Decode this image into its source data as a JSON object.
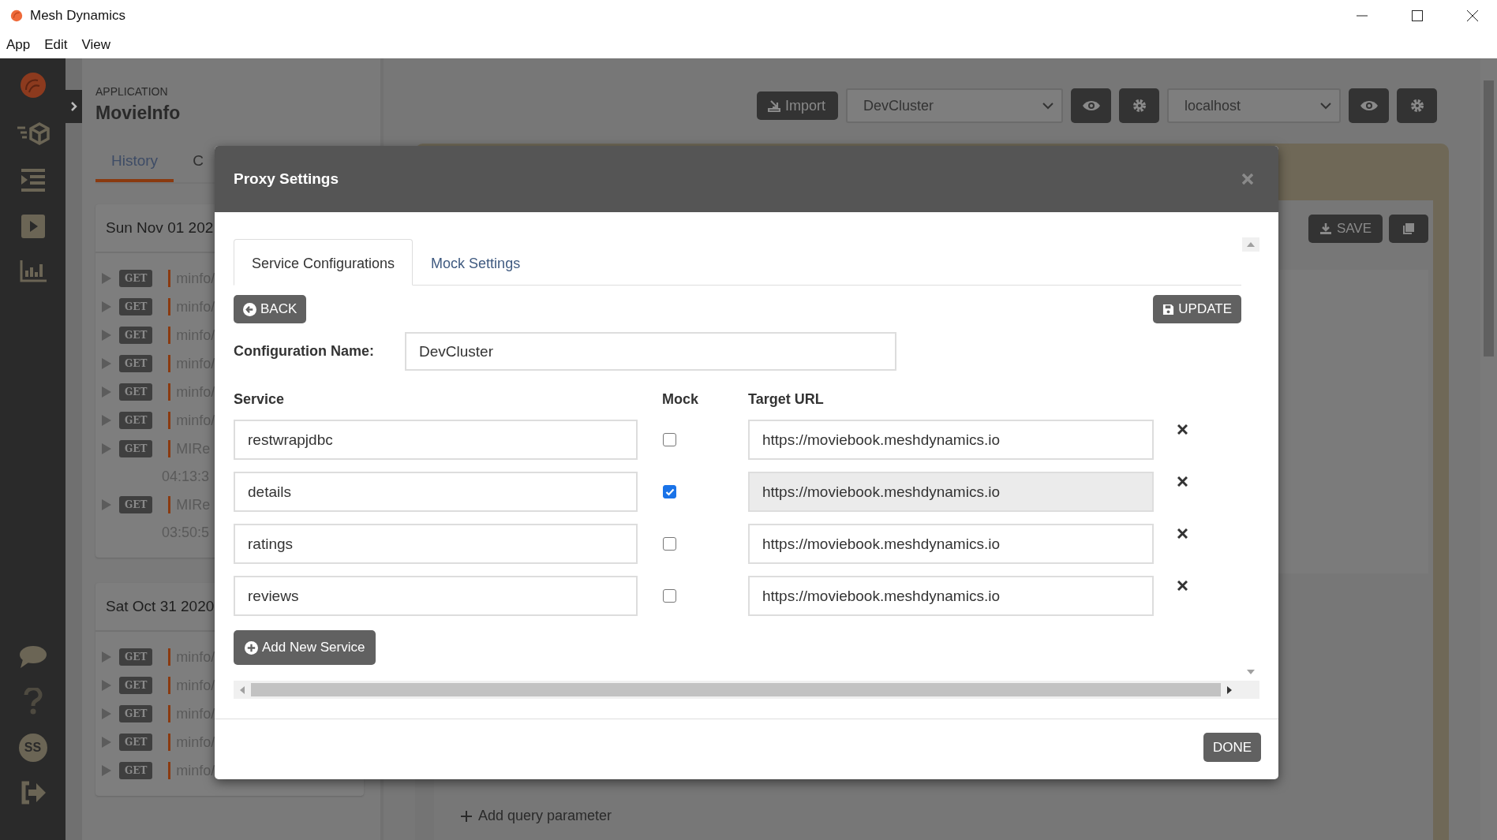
{
  "window": {
    "title": "Mesh Dynamics"
  },
  "menu": [
    "App",
    "Edit",
    "View"
  ],
  "sidebar": {
    "avatar": "SS"
  },
  "application": {
    "label": "APPLICATION",
    "name": "MovieInfo"
  },
  "tabs": [
    {
      "label": "History",
      "selected": true
    },
    {
      "label": "C",
      "selected": false
    }
  ],
  "history_groups": [
    {
      "date": "Sun Nov 01 202",
      "requests": [
        {
          "method": "GET",
          "path": "minfo/"
        },
        {
          "method": "GET",
          "path": "minfo/"
        },
        {
          "method": "GET",
          "path": "minfo/"
        },
        {
          "method": "GET",
          "path": "minfo/"
        },
        {
          "method": "GET",
          "path": "minfo/"
        },
        {
          "method": "GET",
          "path": "minfo/"
        },
        {
          "method": "GET",
          "path": "MIRe",
          "time": "04:13:3"
        },
        {
          "method": "GET",
          "path": "MIRe",
          "time": "03:50:5"
        }
      ]
    },
    {
      "date": "Sat Oct 31 2020",
      "requests": [
        {
          "method": "GET",
          "path": "minfo/"
        },
        {
          "method": "GET",
          "path": "minfo/"
        },
        {
          "method": "GET",
          "path": "minfo/"
        },
        {
          "method": "GET",
          "path": "minfo/"
        },
        {
          "method": "GET",
          "path": "minfo/"
        }
      ]
    }
  ],
  "toolbar": {
    "import": "Import",
    "environment": "DevCluster",
    "host": "localhost"
  },
  "request_actions": {
    "save": "SAVE"
  },
  "add_query_parameter": "Add query parameter",
  "dialog": {
    "title": "Proxy Settings",
    "tabs": [
      {
        "label": "Service Configurations",
        "selected": true
      },
      {
        "label": "Mock Settings",
        "selected": false
      }
    ],
    "back": "BACK",
    "update": "UPDATE",
    "config_label": "Configuration Name:",
    "config_name": "DevCluster",
    "columns": [
      "Service",
      "Mock",
      "Target URL"
    ],
    "services": [
      {
        "name": "restwrapjdbc",
        "mock": false,
        "target_url": "https://moviebook.meshdynamics.io"
      },
      {
        "name": "details",
        "mock": true,
        "target_url": "https://moviebook.meshdynamics.io"
      },
      {
        "name": "ratings",
        "mock": false,
        "target_url": "https://moviebook.meshdynamics.io"
      },
      {
        "name": "reviews",
        "mock": false,
        "target_url": "https://moviebook.meshdynamics.io"
      }
    ],
    "add_button": "Add New Service",
    "done": "DONE"
  }
}
